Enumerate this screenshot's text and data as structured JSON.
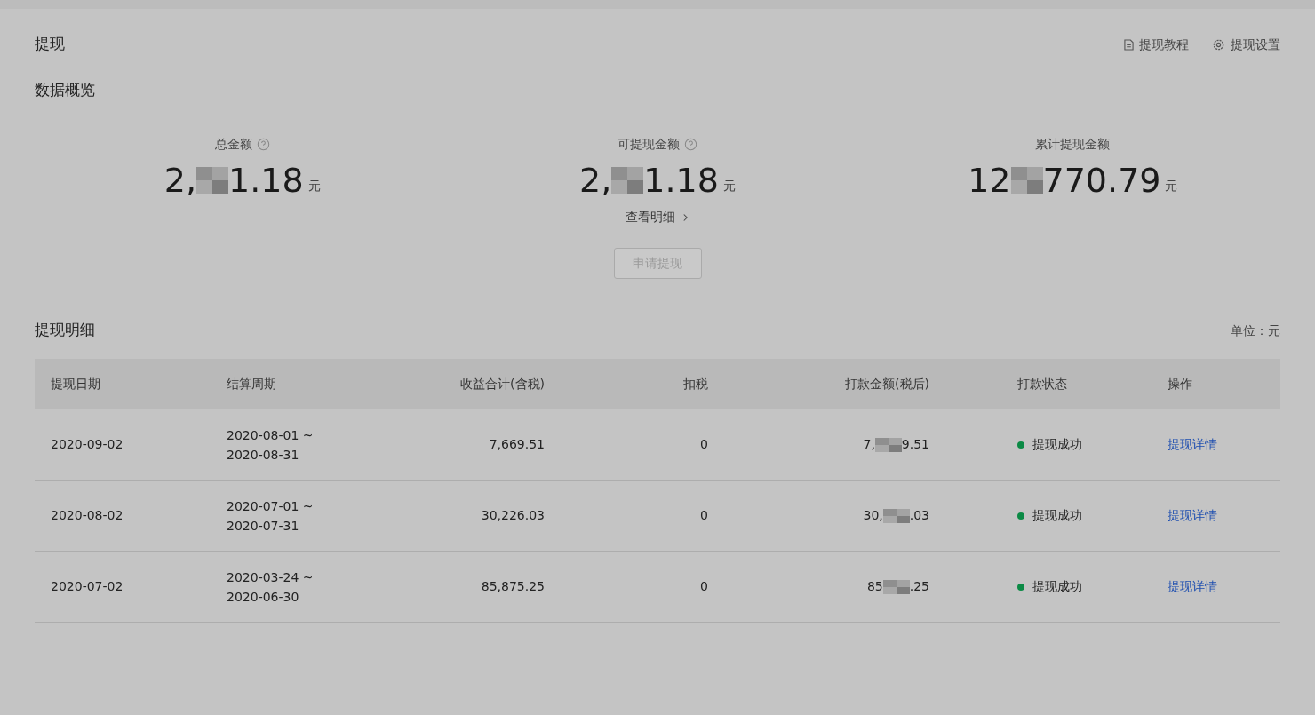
{
  "page_title": "提现",
  "header_links": [
    {
      "kind": "doc",
      "label": "提现教程"
    },
    {
      "kind": "gear",
      "label": "提现设置"
    }
  ],
  "overview": {
    "title": "数据概览",
    "stats": [
      {
        "label": "总金额",
        "help": true,
        "before": "2,",
        "after": "1.18",
        "unit": "元",
        "redacted": true
      },
      {
        "label": "可提现金额",
        "help": true,
        "before": "2,",
        "after": "1.18",
        "unit": "元",
        "redacted": true,
        "link": "查看明细"
      },
      {
        "label": "累计提现金额",
        "help": false,
        "before": "12",
        "after": "770.79",
        "unit": "元",
        "redacted": true
      }
    ],
    "apply_button": {
      "label": "申请提现",
      "disabled": true
    }
  },
  "details": {
    "title": "提现明细",
    "unit_note": "单位：元",
    "columns": [
      "提现日期",
      "结算周期",
      "收益合计(含税)",
      "扣税",
      "打款金额(税后)",
      "打款状态",
      "操作"
    ],
    "rows": [
      {
        "date": "2020-09-02",
        "period_start": "2020-08-01 ~",
        "period_end": "2020-08-31",
        "income": "7,669.51",
        "tax": "0",
        "paid_before": "7,",
        "paid_after": "9.51",
        "redacted": true,
        "status": "提现成功",
        "color": "#0b8a45",
        "action": "提现详情"
      },
      {
        "date": "2020-08-02",
        "period_start": "2020-07-01 ~",
        "period_end": "2020-07-31",
        "income": "30,226.03",
        "tax": "0",
        "paid_before": "30,",
        "paid_after": ".03",
        "redacted": true,
        "status": "提现成功",
        "color": "#0b8a45",
        "action": "提现详情"
      },
      {
        "date": "2020-07-02",
        "period_start": "2020-03-24 ~",
        "period_end": "2020-06-30",
        "income": "85,875.25",
        "tax": "0",
        "paid_before": "85",
        "paid_after": ".25",
        "redacted": true,
        "status": "提现成功",
        "color": "#0b8a45",
        "action": "提现详情"
      }
    ]
  }
}
